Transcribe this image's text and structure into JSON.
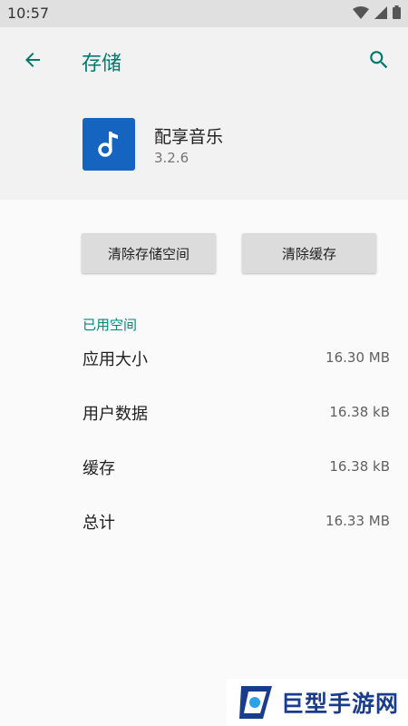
{
  "status_bar": {
    "time": "10:57",
    "icons": [
      "wifi-icon",
      "cellular-icon",
      "battery-icon"
    ]
  },
  "header": {
    "title": "存储",
    "back_icon": "arrow-left-icon",
    "search_icon": "search-icon",
    "accent_color": "#00796b"
  },
  "app": {
    "name": "配享音乐",
    "version": "3.2.6",
    "icon": "music-note-icon",
    "icon_color": "#1565c0"
  },
  "actions": {
    "clear_storage_label": "清除存储空间",
    "clear_cache_label": "清除缓存"
  },
  "usage": {
    "section_title": "已用空间",
    "rows": [
      {
        "label": "应用大小",
        "value": "16.30 MB"
      },
      {
        "label": "用户数据",
        "value": "16.38 kB"
      },
      {
        "label": "缓存",
        "value": "16.38 kB"
      },
      {
        "label": "总计",
        "value": "16.33 MB"
      }
    ]
  },
  "watermark": {
    "text": "巨型手游网"
  }
}
